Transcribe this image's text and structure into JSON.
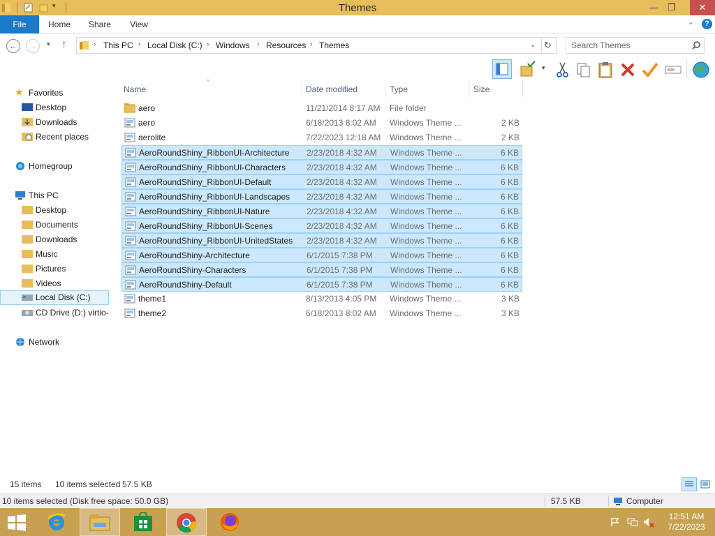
{
  "window": {
    "title": "Themes"
  },
  "ribbon": {
    "tabs": [
      "File",
      "Home",
      "Share",
      "View"
    ]
  },
  "address": {
    "crumbs": [
      "This PC",
      "Local Disk (C:)",
      "Windows",
      "Resources",
      "Themes"
    ]
  },
  "search": {
    "placeholder": "Search Themes"
  },
  "navpane": {
    "favorites": "Favorites",
    "fav_items": [
      "Desktop",
      "Downloads",
      "Recent places"
    ],
    "homegroup": "Homegroup",
    "thispc": "This PC",
    "pc_items": [
      "Desktop",
      "Documents",
      "Downloads",
      "Music",
      "Pictures",
      "Videos",
      "Local Disk (C:)",
      "CD Drive (D:) virtio-v"
    ],
    "network": "Network"
  },
  "columns": {
    "name": "Name",
    "date": "Date modified",
    "type": "Type",
    "size": "Size"
  },
  "files": [
    {
      "name": "aero",
      "date": "11/21/2014 8:17 AM",
      "type": "File folder",
      "size": "",
      "kind": "folder",
      "selected": false
    },
    {
      "name": "aero",
      "date": "6/18/2013 8:02 AM",
      "type": "Windows Theme ...",
      "size": "2 KB",
      "kind": "theme",
      "selected": false
    },
    {
      "name": "aerolite",
      "date": "7/22/2023 12:18 AM",
      "type": "Windows Theme ...",
      "size": "2 KB",
      "kind": "theme",
      "selected": false
    },
    {
      "name": "AeroRoundShiny_RibbonUI-Architecture",
      "date": "2/23/2018 4:32 AM",
      "type": "Windows Theme ...",
      "size": "6 KB",
      "kind": "theme",
      "selected": true
    },
    {
      "name": "AeroRoundShiny_RibbonUI-Characters",
      "date": "2/23/2018 4:32 AM",
      "type": "Windows Theme ...",
      "size": "6 KB",
      "kind": "theme",
      "selected": true
    },
    {
      "name": "AeroRoundShiny_RibbonUI-Default",
      "date": "2/23/2018 4:32 AM",
      "type": "Windows Theme ...",
      "size": "6 KB",
      "kind": "theme",
      "selected": true
    },
    {
      "name": "AeroRoundShiny_RibbonUI-Landscapes",
      "date": "2/23/2018 4:32 AM",
      "type": "Windows Theme ...",
      "size": "6 KB",
      "kind": "theme",
      "selected": true
    },
    {
      "name": "AeroRoundShiny_RibbonUI-Nature",
      "date": "2/23/2018 4:32 AM",
      "type": "Windows Theme ...",
      "size": "6 KB",
      "kind": "theme",
      "selected": true
    },
    {
      "name": "AeroRoundShiny_RibbonUI-Scenes",
      "date": "2/23/2018 4:32 AM",
      "type": "Windows Theme ...",
      "size": "6 KB",
      "kind": "theme",
      "selected": true
    },
    {
      "name": "AeroRoundShiny_RibbonUI-UnitedStates",
      "date": "2/23/2018 4:32 AM",
      "type": "Windows Theme ...",
      "size": "6 KB",
      "kind": "theme",
      "selected": true
    },
    {
      "name": "AeroRoundShiny-Architecture",
      "date": "6/1/2015 7:38 PM",
      "type": "Windows Theme ...",
      "size": "6 KB",
      "kind": "theme",
      "selected": true
    },
    {
      "name": "AeroRoundShiny-Characters",
      "date": "6/1/2015 7:38 PM",
      "type": "Windows Theme ...",
      "size": "6 KB",
      "kind": "theme",
      "selected": true
    },
    {
      "name": "AeroRoundShiny-Default",
      "date": "6/1/2015 7:38 PM",
      "type": "Windows Theme ...",
      "size": "6 KB",
      "kind": "theme",
      "selected": true
    },
    {
      "name": "theme1",
      "date": "8/13/2013 4:05 PM",
      "type": "Windows Theme ...",
      "size": "3 KB",
      "kind": "theme",
      "selected": false
    },
    {
      "name": "theme2",
      "date": "6/18/2013 8:02 AM",
      "type": "Windows Theme ...",
      "size": "3 KB",
      "kind": "theme",
      "selected": false
    }
  ],
  "status": {
    "item_count": "15 items",
    "selected_count": "10 items selected",
    "selected_size": "57.5 KB"
  },
  "details": {
    "summary": "10 items selected (Disk free space: 50.0 GB)",
    "size": "57.5 KB",
    "location": "Computer"
  },
  "taskbar": {
    "time": "12:51 AM",
    "date": "7/22/2023",
    "apps": [
      "start-icon",
      "internet-explorer-icon",
      "file-explorer-icon",
      "store-icon",
      "chrome-icon",
      "firefox-icon"
    ]
  },
  "colors": {
    "title_bar": "#e8bd5b",
    "file_tab": "#1979ca",
    "selection": "#cce8ff",
    "selection_border": "#99d1ff",
    "taskbar": "#c8a052"
  }
}
